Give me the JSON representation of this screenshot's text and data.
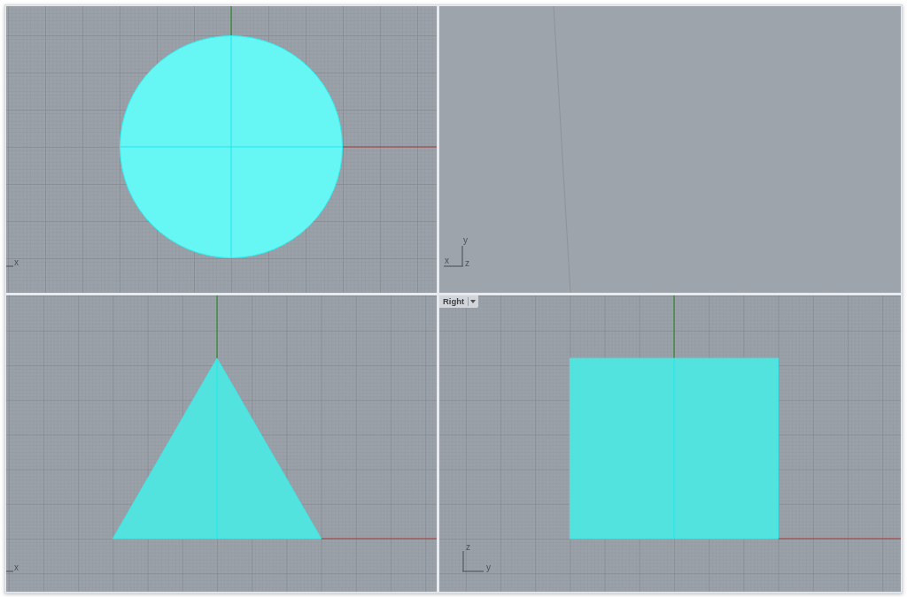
{
  "viewports": [
    {
      "grid": true,
      "shape": {
        "kind": "circle"
      },
      "axis_triad": {
        "kind": "single",
        "labels": [
          "x"
        ]
      }
    },
    {
      "grid": false,
      "shape": {
        "kind": "line"
      },
      "axis_triad": {
        "kind": "corner_left",
        "labels": [
          "y",
          "x",
          "z"
        ]
      }
    },
    {
      "grid": true,
      "shape": {
        "kind": "triangle"
      },
      "axis_triad": {
        "kind": "single",
        "labels": [
          "x"
        ]
      }
    },
    {
      "grid": true,
      "title": "Right",
      "shape": {
        "kind": "rectangle"
      },
      "axis_triad": {
        "kind": "corner_right",
        "labels": [
          "z",
          "y"
        ]
      }
    }
  ]
}
